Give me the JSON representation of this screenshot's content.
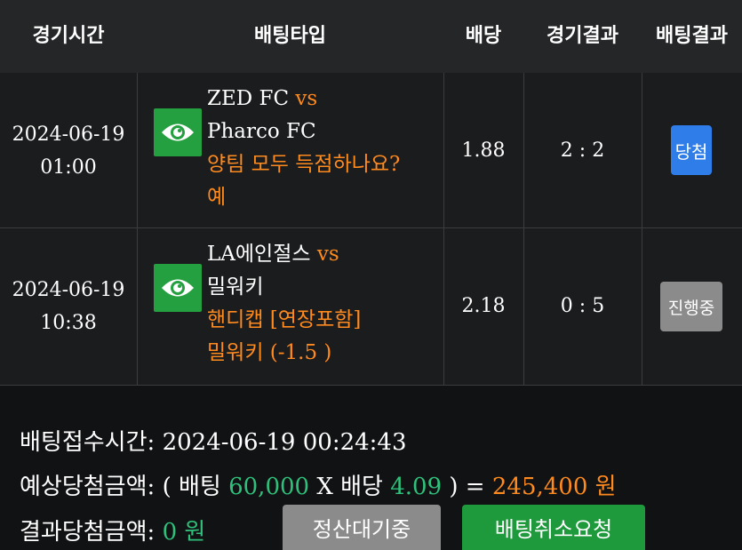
{
  "header": {
    "time": "경기시간",
    "type": "배팅타입",
    "odds": "배당",
    "result": "경기결과",
    "bet_result": "배팅결과"
  },
  "rows": [
    {
      "date": "2024-06-19",
      "time": "01:00",
      "home": "ZED FC",
      "vs": "vs",
      "away": "Pharco FC",
      "market": "양팀 모두 득점하나요?",
      "pick": "예",
      "odds": "1.88",
      "score": "2 : 2",
      "status": "당첨",
      "icon": "eye-icon"
    },
    {
      "date": "2024-06-19",
      "time": "10:38",
      "home": "LA에인절스",
      "vs": "vs",
      "away": "밀워키",
      "market": "핸디캡 [연장포함]",
      "pick": "밀워키 (-1.5 )",
      "odds": "2.18",
      "score": "0 : 5",
      "status": "진행중",
      "icon": "eye-icon"
    }
  ],
  "summary": {
    "receipt_label": "배팅접수시간",
    "receipt_time": "2024-06-19 00:24:43",
    "expected_label": "예상당첨금액",
    "open_paren": "( ",
    "bet_label": "배팅",
    "bet_amount": "60,000",
    "times": "X",
    "odds_label": "배당",
    "total_odds": "4.09",
    "close_eq": " ) = ",
    "expected_amount": "245,400 원",
    "result_label": "결과당첨금액",
    "result_amount": "0 원"
  },
  "buttons": {
    "pending": "정산대기중",
    "cancel": "배팅취소요청"
  },
  "colors": {
    "accent_orange": "#ff8a1e",
    "accent_green": "#2fc07b",
    "win_blue": "#2f7de9",
    "button_green": "#1e9a3c",
    "button_gray": "#8b8b8b"
  }
}
